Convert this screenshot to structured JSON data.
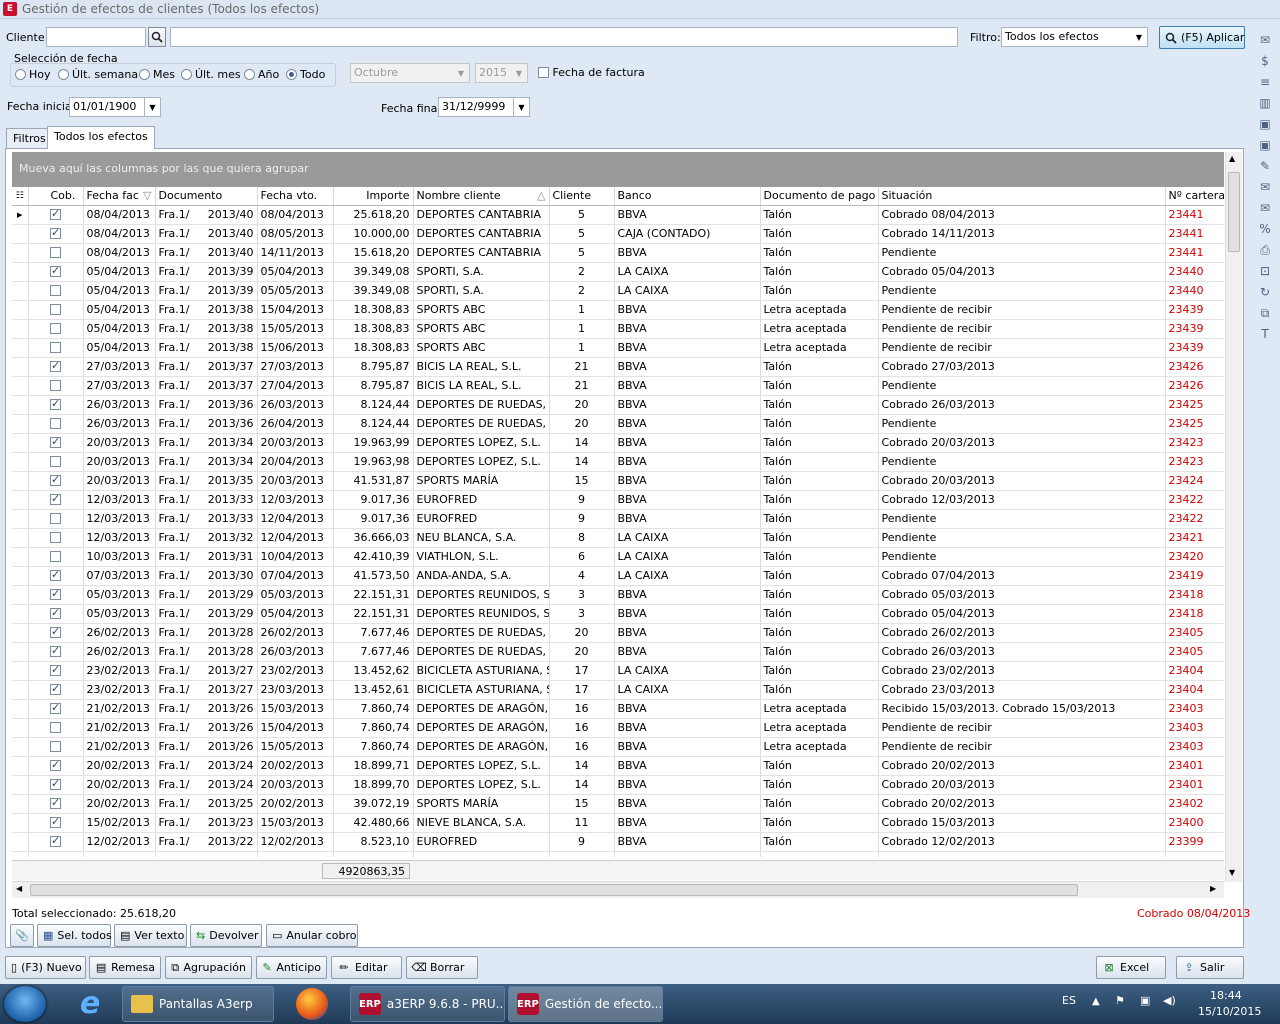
{
  "window": {
    "title": "Gestión de efectos de clientes (Todos los efectos)",
    "app_icon": "E"
  },
  "filter": {
    "cliente_label": "Cliente:",
    "cliente_value": "",
    "search_value": "",
    "filtro_label": "Filtro:",
    "filtro_value": "Todos los efectos",
    "apply_label": "(F5) Aplicar"
  },
  "date_sel": {
    "title": "Selección de fecha",
    "options": [
      "Hoy",
      "Últ. semana",
      "Mes",
      "Últ. mes",
      "Año",
      "Todo"
    ],
    "selected": "Todo",
    "month": "Octubre",
    "year": "2015",
    "factura_label": "Fecha de factura",
    "inicial_label": "Fecha inicial:",
    "inicial_value": "01/01/1900",
    "final_label": "Fecha final:",
    "final_value": "31/12/9999"
  },
  "tabs": [
    "Filtros",
    "Todos los efectos"
  ],
  "groupbar": "Mueva aquí las columnas por las que quiera agrupar",
  "columns": [
    "Cob.",
    "Fecha fac",
    "Documento",
    "Fecha vto.",
    "Importe",
    "Nombre cliente",
    "Cliente",
    "Banco",
    "Documento de pago",
    "Situación",
    "Nº cartera"
  ],
  "rows": [
    {
      "cob": true,
      "ffac": "08/04/2013",
      "doc": "Fra.1/",
      "num": "2013/40",
      "fvto": "08/04/2013",
      "imp": "25.618,20",
      "nombre": "DEPORTES CANTABRIA",
      "cli": "5",
      "banco": "BBVA",
      "pago": "Talón",
      "sit": "Cobrado 08/04/2013",
      "cart": "23441"
    },
    {
      "cob": true,
      "ffac": "08/04/2013",
      "doc": "Fra.1/",
      "num": "2013/40",
      "fvto": "08/05/2013",
      "imp": "10.000,00",
      "nombre": "DEPORTES CANTABRIA",
      "cli": "5",
      "banco": "CAJA (CONTADO)",
      "pago": "Talón",
      "sit": "Cobrado 14/11/2013",
      "cart": "23441"
    },
    {
      "cob": false,
      "ffac": "08/04/2013",
      "doc": "Fra.1/",
      "num": "2013/40",
      "fvto": "14/11/2013",
      "imp": "15.618,20",
      "nombre": "DEPORTES CANTABRIA",
      "cli": "5",
      "banco": "BBVA",
      "pago": "Talón",
      "sit": "Pendiente",
      "cart": "23441"
    },
    {
      "cob": true,
      "ffac": "05/04/2013",
      "doc": "Fra.1/",
      "num": "2013/39",
      "fvto": "05/04/2013",
      "imp": "39.349,08",
      "nombre": "SPORTI, S.A.",
      "cli": "2",
      "banco": "LA CAIXA",
      "pago": "Talón",
      "sit": "Cobrado 05/04/2013",
      "cart": "23440"
    },
    {
      "cob": false,
      "ffac": "05/04/2013",
      "doc": "Fra.1/",
      "num": "2013/39",
      "fvto": "05/05/2013",
      "imp": "39.349,08",
      "nombre": "SPORTI, S.A.",
      "cli": "2",
      "banco": "LA CAIXA",
      "pago": "Talón",
      "sit": "Pendiente",
      "cart": "23440"
    },
    {
      "cob": false,
      "ffac": "05/04/2013",
      "doc": "Fra.1/",
      "num": "2013/38",
      "fvto": "15/04/2013",
      "imp": "18.308,83",
      "nombre": "SPORTS ABC",
      "cli": "1",
      "banco": "BBVA",
      "pago": "Letra aceptada",
      "sit": "Pendiente de recibir",
      "cart": "23439"
    },
    {
      "cob": false,
      "ffac": "05/04/2013",
      "doc": "Fra.1/",
      "num": "2013/38",
      "fvto": "15/05/2013",
      "imp": "18.308,83",
      "nombre": "SPORTS ABC",
      "cli": "1",
      "banco": "BBVA",
      "pago": "Letra aceptada",
      "sit": "Pendiente de recibir",
      "cart": "23439"
    },
    {
      "cob": false,
      "ffac": "05/04/2013",
      "doc": "Fra.1/",
      "num": "2013/38",
      "fvto": "15/06/2013",
      "imp": "18.308,83",
      "nombre": "SPORTS ABC",
      "cli": "1",
      "banco": "BBVA",
      "pago": "Letra aceptada",
      "sit": "Pendiente de recibir",
      "cart": "23439"
    },
    {
      "cob": true,
      "ffac": "27/03/2013",
      "doc": "Fra.1/",
      "num": "2013/37",
      "fvto": "27/03/2013",
      "imp": "8.795,87",
      "nombre": "BICIS LA REAL, S.L.",
      "cli": "21",
      "banco": "BBVA",
      "pago": "Talón",
      "sit": "Cobrado 27/03/2013",
      "cart": "23426"
    },
    {
      "cob": false,
      "ffac": "27/03/2013",
      "doc": "Fra.1/",
      "num": "2013/37",
      "fvto": "27/04/2013",
      "imp": "8.795,87",
      "nombre": "BICIS LA REAL, S.L.",
      "cli": "21",
      "banco": "BBVA",
      "pago": "Talón",
      "sit": "Pendiente",
      "cart": "23426"
    },
    {
      "cob": true,
      "ffac": "26/03/2013",
      "doc": "Fra.1/",
      "num": "2013/36",
      "fvto": "26/03/2013",
      "imp": "8.124,44",
      "nombre": "DEPORTES DE RUEDAS, S.L",
      "cli": "20",
      "banco": "BBVA",
      "pago": "Talón",
      "sit": "Cobrado 26/03/2013",
      "cart": "23425"
    },
    {
      "cob": false,
      "ffac": "26/03/2013",
      "doc": "Fra.1/",
      "num": "2013/36",
      "fvto": "26/04/2013",
      "imp": "8.124,44",
      "nombre": "DEPORTES DE RUEDAS, S.L",
      "cli": "20",
      "banco": "BBVA",
      "pago": "Talón",
      "sit": "Pendiente",
      "cart": "23425"
    },
    {
      "cob": true,
      "ffac": "20/03/2013",
      "doc": "Fra.1/",
      "num": "2013/34",
      "fvto": "20/03/2013",
      "imp": "19.963,99",
      "nombre": "DEPORTES LOPEZ, S.L.",
      "cli": "14",
      "banco": "BBVA",
      "pago": "Talón",
      "sit": "Cobrado 20/03/2013",
      "cart": "23423"
    },
    {
      "cob": false,
      "ffac": "20/03/2013",
      "doc": "Fra.1/",
      "num": "2013/34",
      "fvto": "20/04/2013",
      "imp": "19.963,98",
      "nombre": "DEPORTES LOPEZ, S.L.",
      "cli": "14",
      "banco": "BBVA",
      "pago": "Talón",
      "sit": "Pendiente",
      "cart": "23423"
    },
    {
      "cob": true,
      "ffac": "20/03/2013",
      "doc": "Fra.1/",
      "num": "2013/35",
      "fvto": "20/03/2013",
      "imp": "41.531,87",
      "nombre": "SPORTS MARÍA",
      "cli": "15",
      "banco": "BBVA",
      "pago": "Talón",
      "sit": "Cobrado 20/03/2013",
      "cart": "23424"
    },
    {
      "cob": true,
      "ffac": "12/03/2013",
      "doc": "Fra.1/",
      "num": "2013/33",
      "fvto": "12/03/2013",
      "imp": "9.017,36",
      "nombre": "EUROFRED",
      "cli": "9",
      "banco": "BBVA",
      "pago": "Talón",
      "sit": "Cobrado 12/03/2013",
      "cart": "23422"
    },
    {
      "cob": false,
      "ffac": "12/03/2013",
      "doc": "Fra.1/",
      "num": "2013/33",
      "fvto": "12/04/2013",
      "imp": "9.017,36",
      "nombre": "EUROFRED",
      "cli": "9",
      "banco": "BBVA",
      "pago": "Talón",
      "sit": "Pendiente",
      "cart": "23422"
    },
    {
      "cob": false,
      "ffac": "12/03/2013",
      "doc": "Fra.1/",
      "num": "2013/32",
      "fvto": "12/04/2013",
      "imp": "36.666,03",
      "nombre": "NEU BLANCA, S.A.",
      "cli": "8",
      "banco": "LA CAIXA",
      "pago": "Talón",
      "sit": "Pendiente",
      "cart": "23421"
    },
    {
      "cob": false,
      "ffac": "10/03/2013",
      "doc": "Fra.1/",
      "num": "2013/31",
      "fvto": "10/04/2013",
      "imp": "42.410,39",
      "nombre": "VIATHLON, S.L.",
      "cli": "6",
      "banco": "LA CAIXA",
      "pago": "Talón",
      "sit": "Pendiente",
      "cart": "23420"
    },
    {
      "cob": true,
      "ffac": "07/03/2013",
      "doc": "Fra.1/",
      "num": "2013/30",
      "fvto": "07/04/2013",
      "imp": "41.573,50",
      "nombre": "ANDA-ANDA, S.A.",
      "cli": "4",
      "banco": "LA CAIXA",
      "pago": "Talón",
      "sit": "Cobrado 07/04/2013",
      "cart": "23419"
    },
    {
      "cob": true,
      "ffac": "05/03/2013",
      "doc": "Fra.1/",
      "num": "2013/29",
      "fvto": "05/03/2013",
      "imp": "22.151,31",
      "nombre": "DEPORTES REUNIDOS, S.L.",
      "cli": "3",
      "banco": "BBVA",
      "pago": "Talón",
      "sit": "Cobrado 05/03/2013",
      "cart": "23418"
    },
    {
      "cob": true,
      "ffac": "05/03/2013",
      "doc": "Fra.1/",
      "num": "2013/29",
      "fvto": "05/04/2013",
      "imp": "22.151,31",
      "nombre": "DEPORTES REUNIDOS, S.L.",
      "cli": "3",
      "banco": "BBVA",
      "pago": "Talón",
      "sit": "Cobrado 05/04/2013",
      "cart": "23418"
    },
    {
      "cob": true,
      "ffac": "26/02/2013",
      "doc": "Fra.1/",
      "num": "2013/28",
      "fvto": "26/02/2013",
      "imp": "7.677,46",
      "nombre": "DEPORTES DE RUEDAS, S.L",
      "cli": "20",
      "banco": "BBVA",
      "pago": "Talón",
      "sit": "Cobrado 26/02/2013",
      "cart": "23405"
    },
    {
      "cob": true,
      "ffac": "26/02/2013",
      "doc": "Fra.1/",
      "num": "2013/28",
      "fvto": "26/03/2013",
      "imp": "7.677,46",
      "nombre": "DEPORTES DE RUEDAS, S.L",
      "cli": "20",
      "banco": "BBVA",
      "pago": "Talón",
      "sit": "Cobrado 26/03/2013",
      "cart": "23405"
    },
    {
      "cob": true,
      "ffac": "23/02/2013",
      "doc": "Fra.1/",
      "num": "2013/27",
      "fvto": "23/02/2013",
      "imp": "13.452,62",
      "nombre": "BICICLETA ASTURIANA, S.I",
      "cli": "17",
      "banco": "LA CAIXA",
      "pago": "Talón",
      "sit": "Cobrado 23/02/2013",
      "cart": "23404"
    },
    {
      "cob": true,
      "ffac": "23/02/2013",
      "doc": "Fra.1/",
      "num": "2013/27",
      "fvto": "23/03/2013",
      "imp": "13.452,61",
      "nombre": "BICICLETA ASTURIANA, S.I",
      "cli": "17",
      "banco": "LA CAIXA",
      "pago": "Talón",
      "sit": "Cobrado 23/03/2013",
      "cart": "23404"
    },
    {
      "cob": true,
      "ffac": "21/02/2013",
      "doc": "Fra.1/",
      "num": "2013/26",
      "fvto": "15/03/2013",
      "imp": "7.860,74",
      "nombre": "DEPORTES DE ARAGÓN, S.",
      "cli": "16",
      "banco": "BBVA",
      "pago": "Letra aceptada",
      "sit": "Recibido 15/03/2013. Cobrado 15/03/2013",
      "cart": "23403"
    },
    {
      "cob": false,
      "ffac": "21/02/2013",
      "doc": "Fra.1/",
      "num": "2013/26",
      "fvto": "15/04/2013",
      "imp": "7.860,74",
      "nombre": "DEPORTES DE ARAGÓN, S.",
      "cli": "16",
      "banco": "BBVA",
      "pago": "Letra aceptada",
      "sit": "Pendiente de recibir",
      "cart": "23403"
    },
    {
      "cob": false,
      "ffac": "21/02/2013",
      "doc": "Fra.1/",
      "num": "2013/26",
      "fvto": "15/05/2013",
      "imp": "7.860,74",
      "nombre": "DEPORTES DE ARAGÓN, S.",
      "cli": "16",
      "banco": "BBVA",
      "pago": "Letra aceptada",
      "sit": "Pendiente de recibir",
      "cart": "23403"
    },
    {
      "cob": true,
      "ffac": "20/02/2013",
      "doc": "Fra.1/",
      "num": "2013/24",
      "fvto": "20/02/2013",
      "imp": "18.899,71",
      "nombre": "DEPORTES LOPEZ, S.L.",
      "cli": "14",
      "banco": "BBVA",
      "pago": "Talón",
      "sit": "Cobrado 20/02/2013",
      "cart": "23401"
    },
    {
      "cob": true,
      "ffac": "20/02/2013",
      "doc": "Fra.1/",
      "num": "2013/24",
      "fvto": "20/03/2013",
      "imp": "18.899,70",
      "nombre": "DEPORTES LOPEZ, S.L.",
      "cli": "14",
      "banco": "BBVA",
      "pago": "Talón",
      "sit": "Cobrado 20/03/2013",
      "cart": "23401"
    },
    {
      "cob": true,
      "ffac": "20/02/2013",
      "doc": "Fra.1/",
      "num": "2013/25",
      "fvto": "20/02/2013",
      "imp": "39.072,19",
      "nombre": "SPORTS MARÍA",
      "cli": "15",
      "banco": "BBVA",
      "pago": "Talón",
      "sit": "Cobrado 20/02/2013",
      "cart": "23402"
    },
    {
      "cob": true,
      "ffac": "15/02/2013",
      "doc": "Fra.1/",
      "num": "2013/23",
      "fvto": "15/03/2013",
      "imp": "42.480,66",
      "nombre": "NIEVE BLANCA, S.A.",
      "cli": "11",
      "banco": "BBVA",
      "pago": "Talón",
      "sit": "Cobrado 15/03/2013",
      "cart": "23400"
    },
    {
      "cob": true,
      "ffac": "12/02/2013",
      "doc": "Fra.1/",
      "num": "2013/22",
      "fvto": "12/02/2013",
      "imp": "8.523,10",
      "nombre": "EUROFRED",
      "cli": "9",
      "banco": "BBVA",
      "pago": "Talón",
      "sit": "Cobrado 12/02/2013",
      "cart": "23399"
    }
  ],
  "sum_total": "4920863,35",
  "status": {
    "total": "Total seleccionado: 25.618,20",
    "situacion": "Cobrado 08/04/2013"
  },
  "grid_buttons": [
    "Sel. todos",
    "Ver texto",
    "Devolver",
    "Anular cobro"
  ],
  "bottom_buttons": [
    "(F3) Nuevo",
    "Remesa",
    "Agrupación",
    "Anticipo",
    "Editar",
    "Borrar"
  ],
  "bottom_right": [
    "Excel",
    "Salir"
  ],
  "taskbar": {
    "items": [
      "Pantallas A3erp",
      "a3ERP 9.6.8 - PRU...",
      "Gestión de efecto..."
    ],
    "lang": "ES",
    "time": "18:44",
    "date": "15/10/2015",
    "erp_badge": "ERP"
  },
  "colors": {
    "red": "#d40000",
    "panel": "#dfe9f5",
    "groupbar": "#9a9a9a"
  }
}
